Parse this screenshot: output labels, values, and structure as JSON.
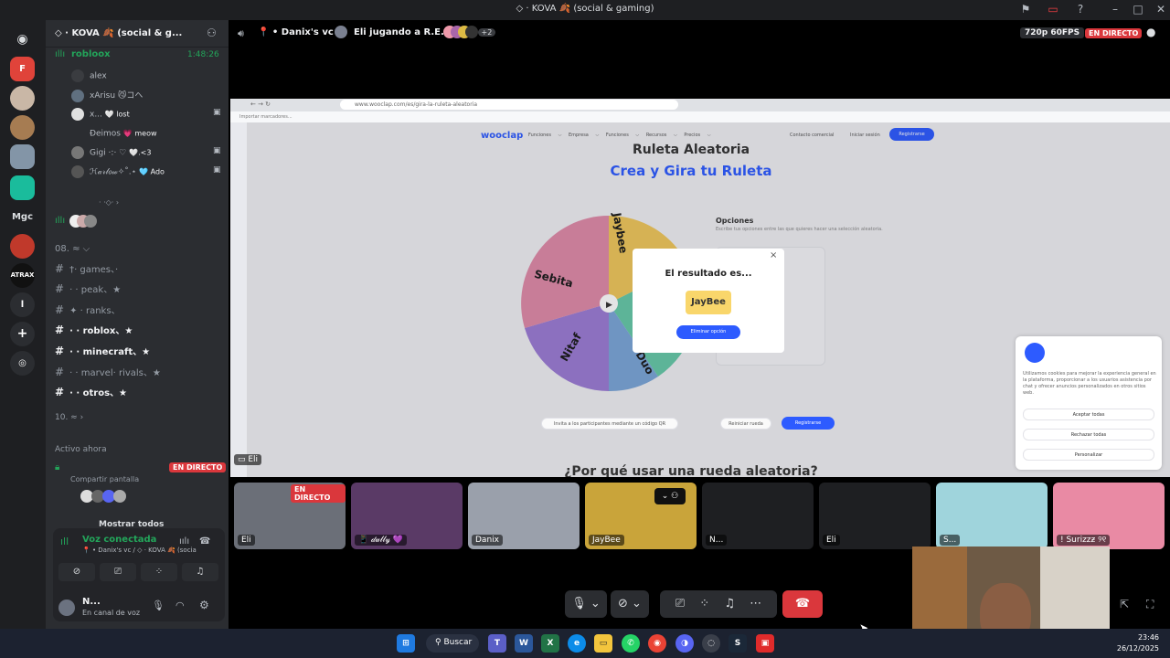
{
  "window": {
    "title": "◇ · KOVA 🍂 (social & gaming)"
  },
  "sidebar": {
    "server_name": "◇ · KOVA 🍂 (social & g...",
    "voice_channel": "robloox",
    "voice_timer": "1:48:26",
    "voice_users": [
      {
        "name": "alex",
        "tag": ""
      },
      {
        "name": "xArisu 😼コヘ",
        "tag": ""
      },
      {
        "name": "x...",
        "tag": "🤍 lost"
      },
      {
        "name": "Đeimos",
        "tag": "💗 meow"
      },
      {
        "name": "Gigi ·:· ♡",
        "tag": "🤍.<3"
      },
      {
        "name": "ℋ𝒶𝓇𝓁𝑜𝓌✧˚.⋆",
        "tag": "🩵 Ado"
      }
    ],
    "divider": "· ·◇· ›",
    "category": "08.   ≈ ⌵",
    "channels": [
      "†· games、·",
      "· · peak、★",
      "✦ · ranks、",
      "· · roblox、★",
      "· · minecraft、★",
      "· · marvel· rivals、★",
      "· · otros、★"
    ],
    "category2": "10.   ≈ ›",
    "active_now": "Activo ahora",
    "live_badge": "EN DIRECTO",
    "share_screen": "Compartir pantalla",
    "show_all": "Mostrar todos",
    "voice_connected": "Voz conectada",
    "voice_location": "📍 • Danix's vc / ◇ · KOVA 🍂 (social &...",
    "user_name": "N...",
    "user_status": "En canal de voz"
  },
  "vc_header": {
    "channel": "📍 • Danix's vc",
    "activity": "Eli jugando a R.E.P.O.",
    "more": "+2",
    "quality": "720p 60FPS",
    "live": "EN DIRECTO"
  },
  "stream": {
    "url": "www.wooclap.com/es/gira-la-ruleta-aleatoria",
    "bookmarks": "Importar marcadores...",
    "logo": "wooclap",
    "nav": [
      "Funciones ⌵",
      "Empresa ⌵",
      "Funciones ⌵",
      "Recursos ⌵",
      "Precios ⌵"
    ],
    "contact": "Contacto comercial",
    "login": "Iniciar sesión",
    "register": "Registrarse",
    "heading1": "Ruleta Aleatoria",
    "heading2": "Crea y Gira tu Ruleta",
    "wheel_labels": [
      "Jaybee",
      "Sebita",
      "Nitaf",
      "Duo"
    ],
    "options_title": "Opciones",
    "options_desc": "Escribe tus opciones entre las que quieres hacer una selección aleatoria.",
    "modal_title": "El resultado es...",
    "modal_result": "JayBee",
    "modal_button": "Eliminar opción",
    "invite": "Invita a los participantes mediante un código QR",
    "reset": "Reiniciar rueda",
    "register2": "Registrarse",
    "bottom_heading": "¿Por qué usar una rueda aleatoria?",
    "cookie_text": "Utilizamos cookies para mejorar la experiencia general en la plataforma, proporcionar a los usuarios asistencia por chat y ofrecer anuncios personalizados en otros sitios web.",
    "cookie_accept": "Aceptar todas",
    "cookie_reject": "Rechazar todas",
    "cookie_custom": "Personalizar",
    "streamer": "Eli"
  },
  "tiles": [
    {
      "name": "Eli",
      "live": "EN DIRECTO",
      "color": "#6b6f78"
    },
    {
      "name": "📱 𝒹𝓊𝓁𝓁𝓎 💜",
      "live": "",
      "color": "#5a3a66"
    },
    {
      "name": "Danix",
      "live": "",
      "color": "#9aa0ab"
    },
    {
      "name": "JayBee",
      "live": "",
      "color": "#c9a43a"
    },
    {
      "name": "N...",
      "live": "",
      "color": "#1e1f22"
    },
    {
      "name": "Eli",
      "live": "",
      "color": "#1e1f22"
    },
    {
      "name": "S...",
      "live": "",
      "color": "#9fd4dc"
    },
    {
      "name": "! Surizzƶ ୨୧",
      "live": "",
      "color": "#e98aa4"
    }
  ],
  "taskbar": {
    "search": "Buscar",
    "time": "23:46",
    "date": "26/12/2025"
  }
}
